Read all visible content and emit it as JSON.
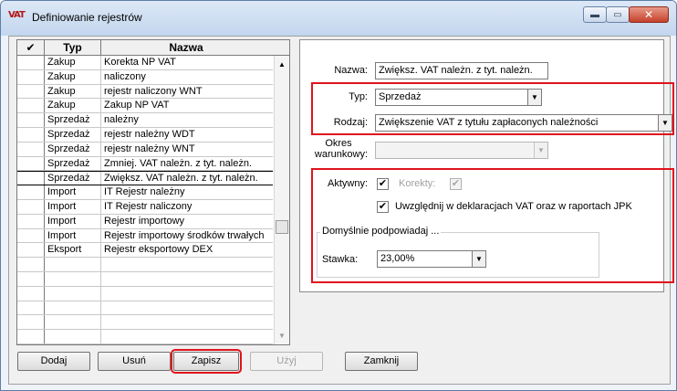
{
  "window": {
    "icon_text": "VAT",
    "title": "Definiowanie rejestrów"
  },
  "grid": {
    "headers": {
      "check": "✔",
      "typ": "Typ",
      "nazwa": "Nazwa"
    },
    "rows": [
      {
        "typ": "Zakup",
        "nazwa": "Korekta NP VAT"
      },
      {
        "typ": "Zakup",
        "nazwa": "naliczony"
      },
      {
        "typ": "Zakup",
        "nazwa": "rejestr naliczony WNT"
      },
      {
        "typ": "Zakup",
        "nazwa": "Zakup NP VAT"
      },
      {
        "typ": "Sprzedaż",
        "nazwa": "należny"
      },
      {
        "typ": "Sprzedaż",
        "nazwa": "rejestr należny WDT"
      },
      {
        "typ": "Sprzedaż",
        "nazwa": "rejestr należny WNT"
      },
      {
        "typ": "Sprzedaż",
        "nazwa": "Zmniej. VAT należn. z tyt. należn."
      },
      {
        "typ": "Sprzedaż",
        "nazwa": "Zwiększ. VAT należn. z tyt. należn."
      },
      {
        "typ": "Import",
        "nazwa": "IT Rejestr należny"
      },
      {
        "typ": "Import",
        "nazwa": "IT Rejestr naliczony"
      },
      {
        "typ": "Import",
        "nazwa": "Rejestr importowy"
      },
      {
        "typ": "Import",
        "nazwa": "Rejestr importowy środków trwałych"
      },
      {
        "typ": "Eksport",
        "nazwa": "Rejestr eksportowy DEX"
      },
      {
        "typ": "",
        "nazwa": ""
      },
      {
        "typ": "",
        "nazwa": ""
      },
      {
        "typ": "",
        "nazwa": ""
      },
      {
        "typ": "",
        "nazwa": ""
      },
      {
        "typ": "",
        "nazwa": ""
      },
      {
        "typ": "",
        "nazwa": ""
      }
    ]
  },
  "form": {
    "nazwa_label": "Nazwa:",
    "nazwa_value": "Zwiększ. VAT należn. z tyt. należn.",
    "typ_label": "Typ:",
    "typ_value": "Sprzedaż",
    "rodzaj_label": "Rodzaj:",
    "rodzaj_value": "Zwiększenie VAT z tytułu zapłaconych należności",
    "okres_label_1": "Okres",
    "okres_label_2": "warunkowy:",
    "okres_value": "",
    "aktywny_label": "Aktywny:",
    "aktywny_checked": true,
    "korekty_label": "Korekty:",
    "korekty_checked": true,
    "uwzglednij_label": "Uwzględnij w deklaracjach VAT oraz w raportach JPK",
    "uwzglednij_checked": true,
    "group_title": "Domyślnie podpowiadaj ...",
    "stawka_label": "Stawka:",
    "stawka_value": "23,00%"
  },
  "buttons": {
    "dodaj": "Dodaj",
    "usun": "Usuń",
    "zapisz": "Zapisz",
    "uzyj": "Użyj",
    "zamknij": "Zamknij"
  },
  "colors": {
    "highlight": "#e0141c",
    "titlebar": "#c3d6ee"
  }
}
